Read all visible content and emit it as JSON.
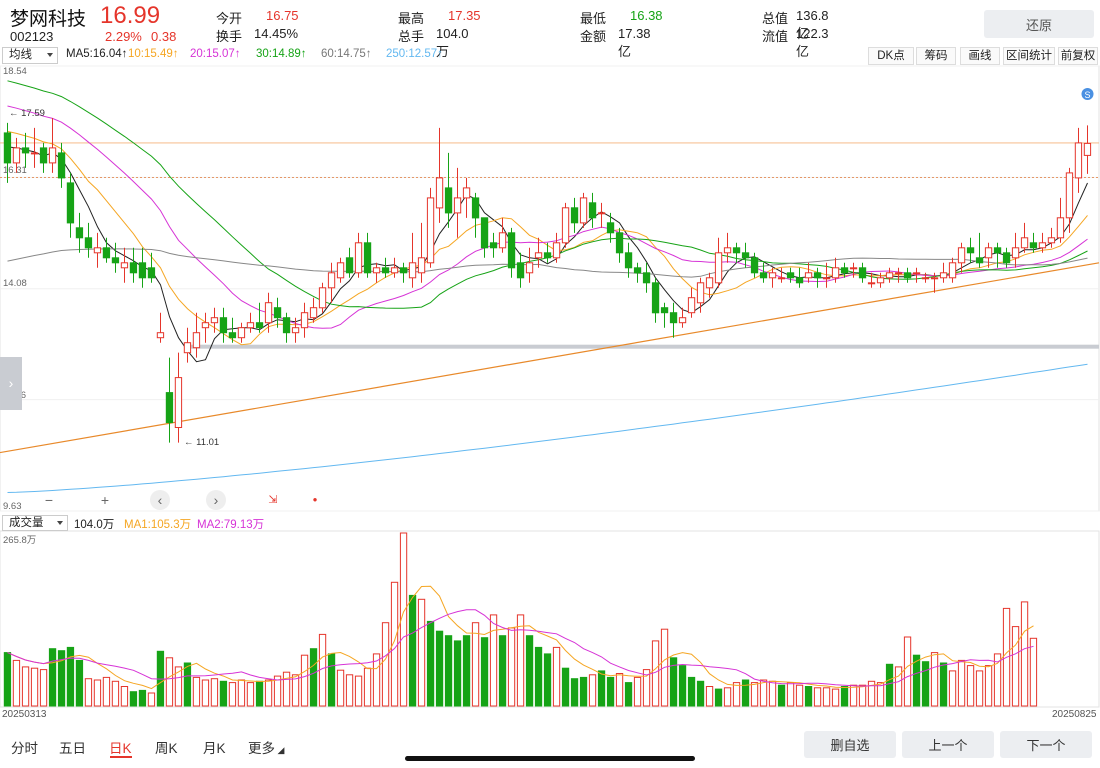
{
  "header": {
    "name": "梦网科技",
    "price": "16.99",
    "code": "002123",
    "pct": "2.29%",
    "chg": "0.38",
    "stats": [
      {
        "k": "今开",
        "v": "16.75",
        "color": "red"
      },
      {
        "k": "最高",
        "v": "17.35",
        "color": "red"
      },
      {
        "k": "最低",
        "v": "16.38",
        "color": "green"
      },
      {
        "k": "总值",
        "v": "136.8亿",
        "color": ""
      },
      {
        "k": "换手",
        "v": "14.45%",
        "color": ""
      },
      {
        "k": "总手",
        "v": "104.0万",
        "color": ""
      },
      {
        "k": "金额",
        "v": "17.38亿",
        "color": ""
      },
      {
        "k": "流值",
        "v": "122.3亿",
        "color": ""
      }
    ],
    "restore": "还原"
  },
  "ma_legend": {
    "selector": "均线",
    "items": [
      {
        "label": "MA5:16.04↑",
        "color": "#222222"
      },
      {
        "label": "10:15.49↑",
        "color": "#f5a623"
      },
      {
        "label": "20:15.07↑",
        "color": "#d633d6"
      },
      {
        "label": "30:14.89↑",
        "color": "#16a316"
      },
      {
        "label": "60:14.75↑",
        "color": "#777777"
      },
      {
        "label": "250:12.57↑",
        "color": "#63b8f0"
      }
    ],
    "tools": [
      "DK点",
      "筹码",
      "画线",
      "区间统计",
      "前复权"
    ]
  },
  "price_axis": [
    "18.54",
    "16.31",
    "14.08",
    "11.86",
    "9.63"
  ],
  "annotations": {
    "high": "17.59",
    "low": "11.01",
    "signal": "S"
  },
  "volume_legend": {
    "selector": "成交量",
    "value": "104.0万",
    "ma1": "MA1:105.3万",
    "ma2": "MA2:79.13万",
    "max": "265.8万"
  },
  "dates": {
    "start": "20250313",
    "end": "20250825"
  },
  "tabs": [
    "分时",
    "五日",
    "日K",
    "周K",
    "月K",
    "更多"
  ],
  "active_tab": 2,
  "buttons": {
    "watch": "删自选",
    "prev": "上一个",
    "next": "下一个"
  },
  "colors": {
    "up": "#e5352b",
    "down": "#16a316"
  },
  "chart_data": {
    "type": "candlestick",
    "ylim": [
      9.63,
      18.54
    ],
    "candles": [
      [
        17.2,
        16.6,
        17.4,
        16.2
      ],
      [
        16.6,
        16.9,
        17.1,
        16.4
      ],
      [
        16.9,
        16.8,
        17.2,
        16.5
      ],
      [
        16.8,
        16.8,
        17.3,
        16.5
      ],
      [
        16.9,
        16.6,
        17.0,
        16.4
      ],
      [
        16.6,
        16.9,
        17.5,
        16.4
      ],
      [
        16.8,
        16.3,
        17.0,
        16.1
      ],
      [
        16.2,
        15.4,
        16.4,
        15.1
      ],
      [
        15.3,
        15.1,
        15.6,
        14.8
      ],
      [
        15.1,
        14.9,
        15.4,
        14.7
      ],
      [
        14.8,
        14.9,
        15.2,
        14.5
      ],
      [
        14.9,
        14.7,
        15.1,
        14.6
      ],
      [
        14.7,
        14.6,
        15.0,
        14.4
      ],
      [
        14.5,
        14.6,
        14.9,
        14.2
      ],
      [
        14.6,
        14.4,
        14.9,
        14.2
      ],
      [
        14.6,
        14.3,
        14.9,
        14.1
      ],
      [
        14.5,
        14.3,
        14.8,
        14.2
      ],
      [
        13.1,
        13.2,
        13.6,
        13.0
      ],
      [
        12.0,
        11.4,
        12.7,
        11.0
      ],
      [
        11.3,
        12.3,
        12.8,
        11.0
      ],
      [
        12.8,
        13.0,
        13.3,
        12.6
      ],
      [
        12.9,
        13.2,
        13.6,
        12.7
      ],
      [
        13.3,
        13.4,
        13.6,
        13.0
      ],
      [
        13.4,
        13.5,
        13.7,
        13.2
      ],
      [
        13.5,
        13.2,
        13.7,
        13.0
      ],
      [
        13.2,
        13.1,
        13.5,
        13.0
      ],
      [
        13.1,
        13.3,
        13.4,
        13.0
      ],
      [
        13.3,
        13.4,
        13.6,
        13.2
      ],
      [
        13.4,
        13.3,
        13.8,
        13.2
      ],
      [
        13.4,
        13.8,
        14.0,
        13.2
      ],
      [
        13.7,
        13.5,
        13.9,
        13.3
      ],
      [
        13.5,
        13.2,
        13.6,
        13.0
      ],
      [
        13.2,
        13.3,
        13.5,
        13.0
      ],
      [
        13.3,
        13.6,
        13.8,
        13.1
      ],
      [
        13.5,
        13.7,
        13.9,
        13.4
      ],
      [
        13.7,
        14.1,
        14.2,
        13.6
      ],
      [
        14.1,
        14.4,
        14.6,
        13.8
      ],
      [
        14.3,
        14.6,
        14.7,
        14.2
      ],
      [
        14.7,
        14.4,
        14.9,
        14.3
      ],
      [
        14.4,
        15.0,
        15.2,
        14.3
      ],
      [
        15.0,
        14.4,
        15.2,
        14.3
      ],
      [
        14.4,
        14.5,
        14.6,
        14.2
      ],
      [
        14.5,
        14.4,
        14.7,
        14.3
      ],
      [
        14.4,
        14.5,
        14.7,
        14.3
      ],
      [
        14.5,
        14.4,
        14.6,
        14.2
      ],
      [
        14.3,
        14.6,
        15.2,
        14.1
      ],
      [
        14.4,
        14.7,
        15.4,
        14.2
      ],
      [
        14.6,
        15.9,
        16.1,
        14.5
      ],
      [
        15.7,
        16.3,
        17.3,
        15.4
      ],
      [
        16.1,
        15.6,
        16.8,
        15.3
      ],
      [
        15.6,
        15.9,
        16.5,
        15.1
      ],
      [
        15.9,
        16.1,
        16.3,
        15.5
      ],
      [
        15.9,
        15.5,
        16.0,
        15.1
      ],
      [
        15.5,
        14.9,
        15.5,
        14.7
      ],
      [
        15.0,
        14.9,
        15.2,
        14.7
      ],
      [
        14.9,
        15.2,
        15.5,
        14.8
      ],
      [
        15.2,
        14.5,
        15.3,
        14.3
      ],
      [
        14.6,
        14.3,
        14.8,
        14.1
      ],
      [
        14.4,
        14.6,
        14.9,
        14.2
      ],
      [
        14.7,
        14.8,
        15.1,
        14.5
      ],
      [
        14.8,
        14.7,
        15.0,
        14.6
      ],
      [
        14.7,
        15.0,
        15.2,
        14.6
      ],
      [
        15.0,
        15.7,
        15.8,
        14.9
      ],
      [
        15.7,
        15.4,
        15.9,
        15.2
      ],
      [
        15.4,
        15.9,
        16.0,
        15.3
      ],
      [
        15.8,
        15.5,
        16.0,
        15.3
      ],
      [
        15.6,
        15.6,
        15.8,
        15.3
      ],
      [
        15.4,
        15.2,
        15.6,
        15.0
      ],
      [
        15.2,
        14.8,
        15.3,
        14.6
      ],
      [
        14.8,
        14.5,
        15.0,
        14.3
      ],
      [
        14.5,
        14.4,
        14.6,
        14.2
      ],
      [
        14.4,
        14.2,
        14.6,
        14.0
      ],
      [
        14.2,
        13.6,
        14.3,
        13.4
      ],
      [
        13.7,
        13.6,
        13.8,
        13.3
      ],
      [
        13.6,
        13.4,
        13.8,
        13.1
      ],
      [
        13.4,
        13.5,
        13.7,
        13.3
      ],
      [
        13.6,
        13.9,
        14.1,
        13.5
      ],
      [
        13.8,
        14.2,
        14.3,
        13.6
      ],
      [
        14.1,
        14.3,
        14.4,
        13.9
      ],
      [
        14.2,
        14.8,
        15.1,
        14.1
      ],
      [
        14.8,
        14.9,
        15.2,
        14.6
      ],
      [
        14.9,
        14.8,
        15.0,
        14.6
      ],
      [
        14.8,
        14.7,
        15.0,
        14.5
      ],
      [
        14.7,
        14.4,
        14.8,
        14.3
      ],
      [
        14.4,
        14.3,
        14.6,
        14.2
      ],
      [
        14.3,
        14.4,
        14.5,
        14.1
      ],
      [
        14.3,
        14.3,
        14.5,
        14.2
      ],
      [
        14.4,
        14.3,
        14.5,
        14.2
      ],
      [
        14.3,
        14.2,
        14.5,
        14.1
      ],
      [
        14.3,
        14.4,
        14.6,
        14.2
      ],
      [
        14.4,
        14.3,
        14.5,
        14.1
      ],
      [
        14.3,
        14.3,
        14.6,
        14.1
      ],
      [
        14.3,
        14.5,
        14.7,
        14.2
      ],
      [
        14.5,
        14.4,
        14.6,
        14.3
      ],
      [
        14.5,
        14.5,
        14.6,
        14.3
      ],
      [
        14.5,
        14.3,
        14.6,
        14.2
      ],
      [
        14.2,
        14.2,
        14.4,
        14.1
      ],
      [
        14.2,
        14.3,
        14.4,
        14.1
      ],
      [
        14.3,
        14.4,
        14.5,
        14.2
      ],
      [
        14.4,
        14.4,
        14.5,
        14.2
      ],
      [
        14.4,
        14.3,
        14.5,
        14.2
      ],
      [
        14.4,
        14.4,
        14.5,
        14.2
      ],
      [
        14.3,
        14.3,
        14.4,
        14.2
      ],
      [
        14.3,
        14.3,
        14.4,
        14.0
      ],
      [
        14.3,
        14.4,
        14.6,
        14.2
      ],
      [
        14.3,
        14.6,
        14.7,
        14.2
      ],
      [
        14.6,
        14.9,
        15.0,
        14.4
      ],
      [
        14.9,
        14.8,
        15.1,
        14.6
      ],
      [
        14.7,
        14.6,
        15.2,
        14.5
      ],
      [
        14.7,
        14.9,
        15.0,
        14.5
      ],
      [
        14.9,
        14.8,
        15.0,
        14.5
      ],
      [
        14.8,
        14.6,
        14.9,
        14.5
      ],
      [
        14.7,
        14.9,
        15.2,
        14.5
      ],
      [
        14.9,
        15.1,
        15.4,
        14.8
      ],
      [
        15.0,
        14.9,
        15.2,
        14.8
      ],
      [
        14.9,
        15.0,
        15.2,
        14.8
      ],
      [
        15.0,
        15.1,
        15.3,
        14.9
      ],
      [
        15.1,
        15.5,
        15.9,
        15.0
      ],
      [
        15.5,
        16.4,
        16.5,
        15.2
      ],
      [
        16.3,
        17.0,
        17.3,
        16.0
      ],
      [
        16.75,
        16.99,
        17.35,
        16.38
      ]
    ],
    "ma5_last": 16.04,
    "ma10_last": 15.49,
    "ma20_last": 15.07,
    "ma30_last": 14.89,
    "ma60_last": 14.75,
    "ma250_last": 12.57,
    "volume_max": 265.8,
    "volumes": [
      {
        "v": 82,
        "up": false
      },
      {
        "v": 70,
        "up": true
      },
      {
        "v": 60,
        "up": true
      },
      {
        "v": 58,
        "up": true
      },
      {
        "v": 56,
        "up": true
      },
      {
        "v": 88,
        "up": false
      },
      {
        "v": 85,
        "up": false
      },
      {
        "v": 90,
        "up": false
      },
      {
        "v": 70,
        "up": false
      },
      {
        "v": 42,
        "up": true
      },
      {
        "v": 40,
        "up": true
      },
      {
        "v": 44,
        "up": true
      },
      {
        "v": 38,
        "up": true
      },
      {
        "v": 30,
        "up": true
      },
      {
        "v": 22,
        "up": false
      },
      {
        "v": 24,
        "up": false
      },
      {
        "v": 20,
        "up": true
      },
      {
        "v": 84,
        "up": false
      },
      {
        "v": 74,
        "up": true
      },
      {
        "v": 60,
        "up": true
      },
      {
        "v": 66,
        "up": false
      },
      {
        "v": 44,
        "up": true
      },
      {
        "v": 40,
        "up": true
      },
      {
        "v": 42,
        "up": true
      },
      {
        "v": 38,
        "up": false
      },
      {
        "v": 36,
        "up": true
      },
      {
        "v": 40,
        "up": true
      },
      {
        "v": 36,
        "up": true
      },
      {
        "v": 38,
        "up": false
      },
      {
        "v": 40,
        "up": true
      },
      {
        "v": 46,
        "up": true
      },
      {
        "v": 52,
        "up": true
      },
      {
        "v": 48,
        "up": true
      },
      {
        "v": 78,
        "up": true
      },
      {
        "v": 88,
        "up": false
      },
      {
        "v": 110,
        "up": true
      },
      {
        "v": 80,
        "up": false
      },
      {
        "v": 55,
        "up": true
      },
      {
        "v": 48,
        "up": true
      },
      {
        "v": 46,
        "up": true
      },
      {
        "v": 58,
        "up": true
      },
      {
        "v": 80,
        "up": true
      },
      {
        "v": 128,
        "up": true
      },
      {
        "v": 190,
        "up": true
      },
      {
        "v": 265.8,
        "up": true
      },
      {
        "v": 170,
        "up": false
      },
      {
        "v": 164,
        "up": true
      },
      {
        "v": 130,
        "up": false
      },
      {
        "v": 115,
        "up": false
      },
      {
        "v": 108,
        "up": false
      },
      {
        "v": 100,
        "up": false
      },
      {
        "v": 108,
        "up": false
      },
      {
        "v": 128,
        "up": true
      },
      {
        "v": 105,
        "up": false
      },
      {
        "v": 140,
        "up": true
      },
      {
        "v": 108,
        "up": false
      },
      {
        "v": 120,
        "up": true
      },
      {
        "v": 140,
        "up": true
      },
      {
        "v": 108,
        "up": false
      },
      {
        "v": 90,
        "up": false
      },
      {
        "v": 80,
        "up": false
      },
      {
        "v": 90,
        "up": true
      },
      {
        "v": 58,
        "up": false
      },
      {
        "v": 42,
        "up": false
      },
      {
        "v": 44,
        "up": false
      },
      {
        "v": 48,
        "up": true
      },
      {
        "v": 54,
        "up": false
      },
      {
        "v": 44,
        "up": false
      },
      {
        "v": 50,
        "up": true
      },
      {
        "v": 36,
        "up": false
      },
      {
        "v": 44,
        "up": true
      },
      {
        "v": 56,
        "up": true
      },
      {
        "v": 100,
        "up": true
      },
      {
        "v": 118,
        "up": true
      },
      {
        "v": 74,
        "up": false
      },
      {
        "v": 62,
        "up": false
      },
      {
        "v": 44,
        "up": false
      },
      {
        "v": 38,
        "up": false
      },
      {
        "v": 30,
        "up": true
      },
      {
        "v": 26,
        "up": false
      },
      {
        "v": 28,
        "up": true
      },
      {
        "v": 36,
        "up": true
      },
      {
        "v": 40,
        "up": false
      },
      {
        "v": 36,
        "up": true
      },
      {
        "v": 40,
        "up": true
      },
      {
        "v": 38,
        "up": true
      },
      {
        "v": 32,
        "up": false
      },
      {
        "v": 36,
        "up": true
      },
      {
        "v": 32,
        "up": true
      },
      {
        "v": 30,
        "up": false
      },
      {
        "v": 28,
        "up": true
      },
      {
        "v": 28,
        "up": true
      },
      {
        "v": 26,
        "up": true
      },
      {
        "v": 30,
        "up": false
      },
      {
        "v": 32,
        "up": true
      },
      {
        "v": 32,
        "up": true
      },
      {
        "v": 38,
        "up": true
      },
      {
        "v": 36,
        "up": true
      },
      {
        "v": 64,
        "up": false
      },
      {
        "v": 60,
        "up": true
      },
      {
        "v": 106,
        "up": true
      },
      {
        "v": 78,
        "up": false
      },
      {
        "v": 68,
        "up": false
      },
      {
        "v": 82,
        "up": true
      },
      {
        "v": 66,
        "up": false
      },
      {
        "v": 54,
        "up": true
      },
      {
        "v": 70,
        "up": true
      },
      {
        "v": 62,
        "up": true
      },
      {
        "v": 54,
        "up": true
      },
      {
        "v": 62,
        "up": true
      },
      {
        "v": 80,
        "up": true
      },
      {
        "v": 150,
        "up": true
      },
      {
        "v": 122,
        "up": true
      },
      {
        "v": 160,
        "up": true
      },
      {
        "v": 104,
        "up": true
      }
    ]
  }
}
